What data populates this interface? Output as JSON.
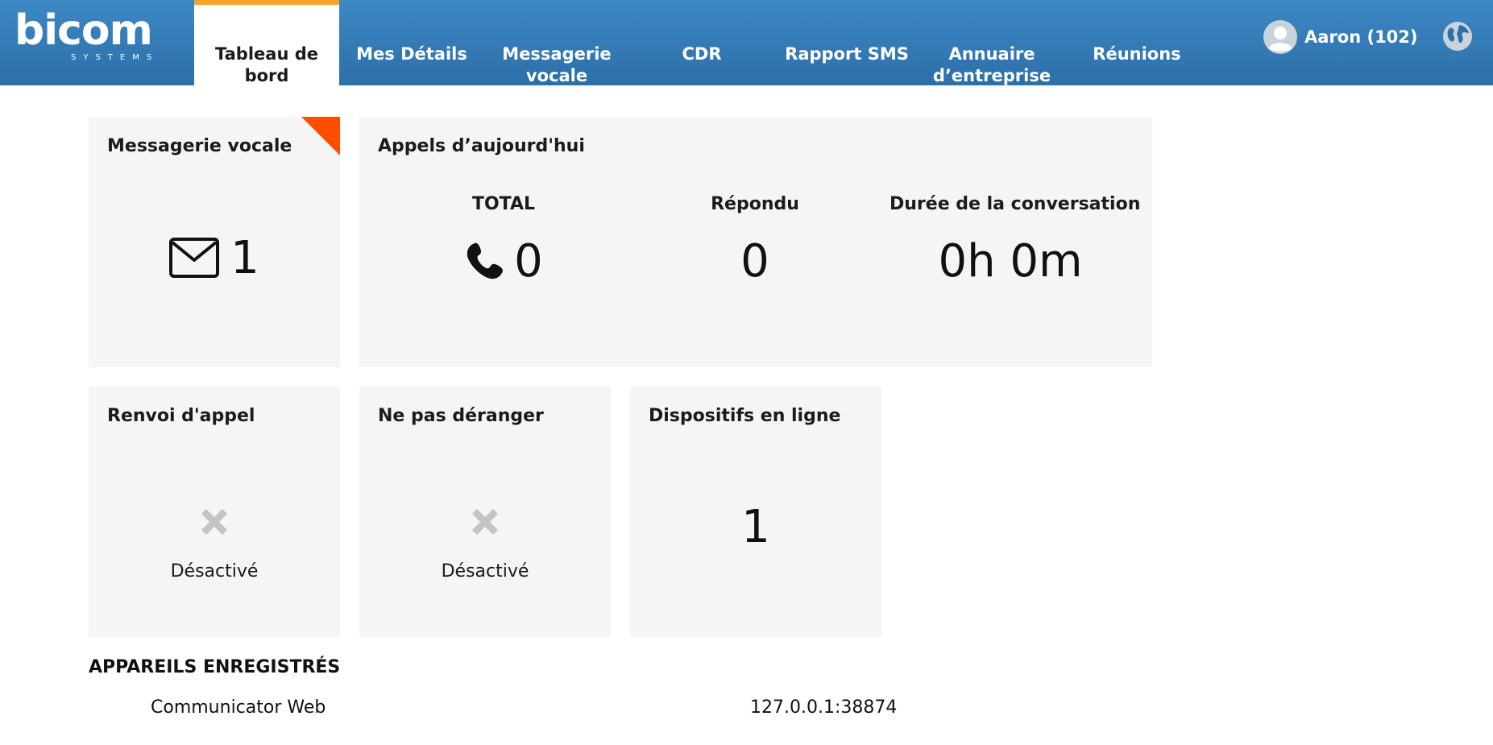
{
  "brand": {
    "name": "bicom",
    "sub": "SYSTEMS"
  },
  "nav": {
    "items": [
      {
        "label": "Tableau de bord"
      },
      {
        "label": "Mes Détails"
      },
      {
        "label": "Messagerie vocale"
      },
      {
        "label": "CDR"
      },
      {
        "label": "Rapport SMS"
      },
      {
        "label": "Annuaire d’entreprise"
      },
      {
        "label": "Réunions"
      }
    ],
    "active_index": 0
  },
  "user": {
    "name": "Aaron (102)",
    "avatar_icon": "user-avatar-icon",
    "language_icon": "globe-icon"
  },
  "colors": {
    "header": "#3d88c5",
    "active_tab_border": "#f5a52a",
    "corner_flag": "#ff4d00",
    "card_bg": "#f5f5f5"
  },
  "voicemail": {
    "title": "Messagerie vocale",
    "count": "1",
    "icon": "envelope-icon"
  },
  "calls_today": {
    "title": "Appels d’aujourd'hui",
    "total_label": "TOTAL",
    "total_value": "0",
    "total_icon": "phone-icon",
    "answered_label": "Répondu",
    "answered_value": "0",
    "duration_label": "Durée de la conversation",
    "duration_value": "0h 0m"
  },
  "call_forward": {
    "title": "Renvoi d'appel",
    "status": "Désactivé",
    "icon": "x-icon"
  },
  "dnd": {
    "title": "Ne pas déranger",
    "status": "Désactivé",
    "icon": "x-icon"
  },
  "devices_online": {
    "title": "Dispositifs en ligne",
    "value": "1"
  },
  "registered_devices": {
    "title": "APPAREILS ENREGISTRÉS",
    "rows": [
      {
        "name": "Communicator Web",
        "address": "127.0.0.1:38874"
      }
    ]
  }
}
